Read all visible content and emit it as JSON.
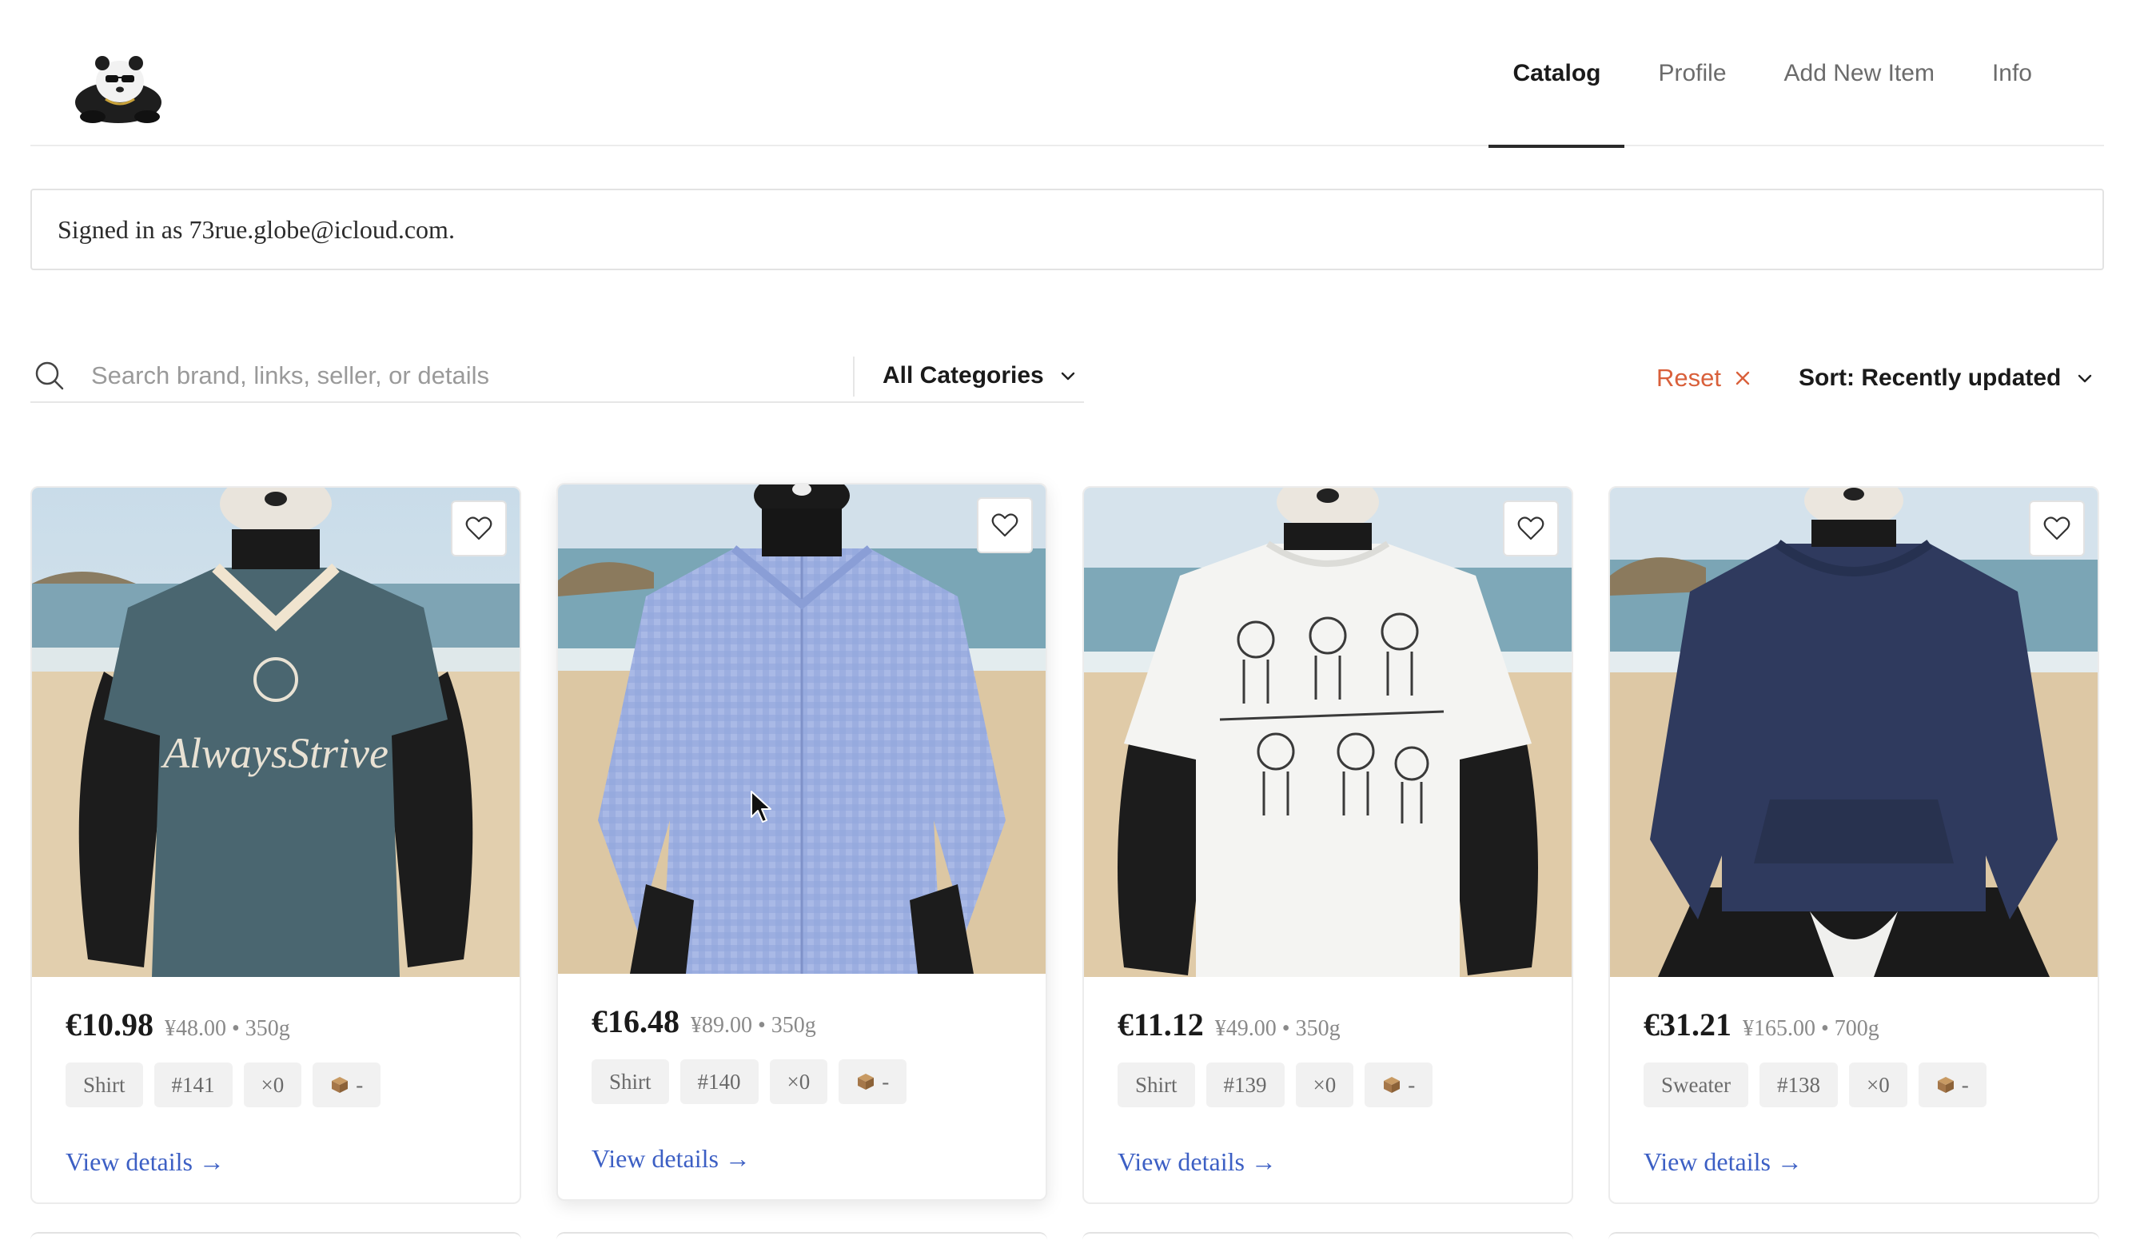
{
  "header": {
    "logo_name": "panda-logo",
    "nav": [
      {
        "label": "Catalog",
        "active": true
      },
      {
        "label": "Profile",
        "active": false
      },
      {
        "label": "Add New Item",
        "active": false
      },
      {
        "label": "Info",
        "active": false
      }
    ]
  },
  "banner": {
    "text": "Signed in as 73rue.globe@icloud.com."
  },
  "filters": {
    "search_placeholder": "Search brand, links, seller, or details",
    "search_value": "",
    "category_label": "All Categories",
    "reset_label": "Reset",
    "sort_label": "Sort: Recently updated"
  },
  "cards": [
    {
      "price": "€10.98",
      "sub": "¥48.00 • 350g",
      "tags": [
        "Shirt",
        "#141",
        "×0",
        "-"
      ],
      "link": "View details →",
      "image": "panda-in-teal-jersey",
      "garment_color": "#4a6670"
    },
    {
      "price": "€16.48",
      "sub": "¥89.00 • 350g",
      "tags": [
        "Shirt",
        "#140",
        "×0",
        "-"
      ],
      "link": "View details →",
      "image": "panda-in-blue-gingham-shirt",
      "garment_color": "#9fb1e0"
    },
    {
      "price": "€11.12",
      "sub": "¥49.00 • 350g",
      "tags": [
        "Shirt",
        "#139",
        "×0",
        "-"
      ],
      "link": "View details →",
      "image": "panda-in-white-dog-sketch-tee",
      "garment_color": "#f4f4f2"
    },
    {
      "price": "€31.21",
      "sub": "¥165.00 • 700g",
      "tags": [
        "Sweater",
        "#138",
        "×0",
        "-"
      ],
      "link": "View details →",
      "image": "panda-in-navy-hoodie",
      "garment_color": "#2f3a5e"
    }
  ],
  "colors": {
    "accent_link": "#3c5fc4",
    "reset": "#d9603b",
    "tag_bg": "#f1f1f1"
  },
  "icons": [
    "search-icon",
    "chevron-down-icon",
    "close-icon",
    "heart-icon",
    "package-icon",
    "arrow-right-icon",
    "mouse-cursor-icon"
  ]
}
